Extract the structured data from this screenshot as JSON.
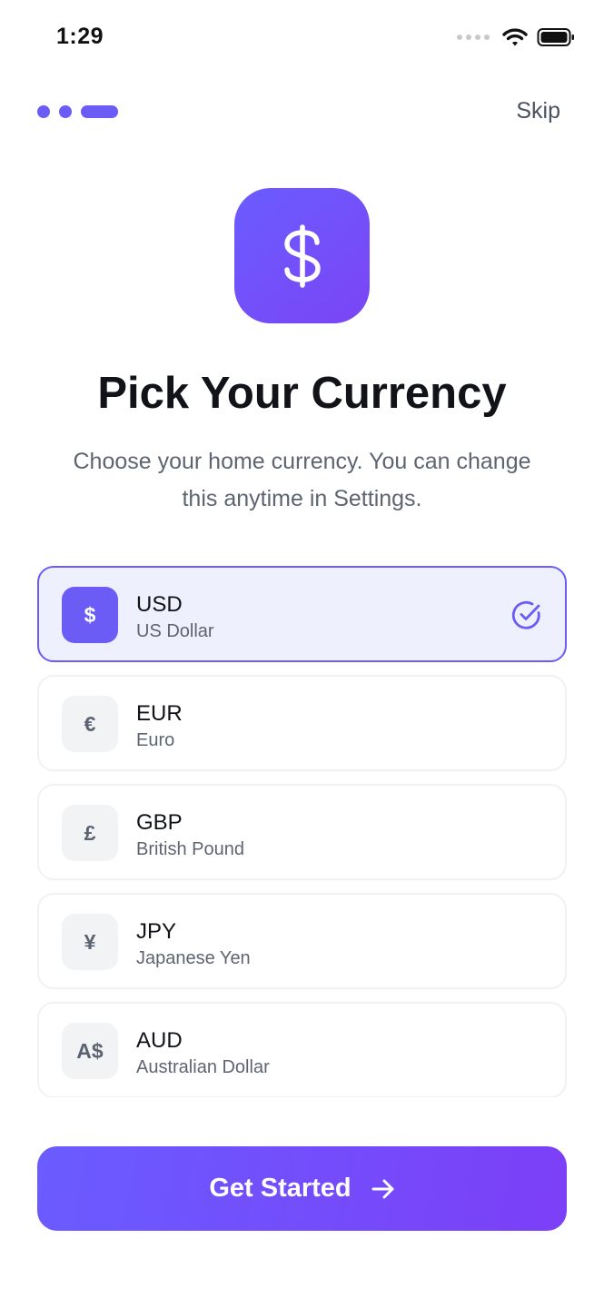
{
  "status_bar": {
    "time": "1:29",
    "icons": [
      "cellular-dots-icon",
      "wifi-icon",
      "battery-icon"
    ]
  },
  "onboarding": {
    "page_indicator": {
      "total": 3,
      "active_index": 2
    },
    "skip_label": "Skip"
  },
  "hero": {
    "icon": "dollar-sign-icon",
    "title": "Pick Your Currency",
    "subtitle_line1": "Choose your home currency. You can change",
    "subtitle_line2": "this anytime in Settings."
  },
  "currencies": [
    {
      "symbol": "$",
      "code": "USD",
      "name": "US Dollar",
      "selected": true
    },
    {
      "symbol": "€",
      "code": "EUR",
      "name": "Euro",
      "selected": false
    },
    {
      "symbol": "£",
      "code": "GBP",
      "name": "British Pound",
      "selected": false
    },
    {
      "symbol": "¥",
      "code": "JPY",
      "name": "Japanese Yen",
      "selected": false
    },
    {
      "symbol": "A$",
      "code": "AUD",
      "name": "Australian Dollar",
      "selected": false
    }
  ],
  "cta": {
    "label": "Get Started",
    "icon": "arrow-right-icon"
  },
  "colors": {
    "accent": "#6b5cf6",
    "accent_end": "#7c3ff7",
    "selected_bg": "#eef1fd",
    "title": "#111318",
    "muted": "#5e6470"
  }
}
